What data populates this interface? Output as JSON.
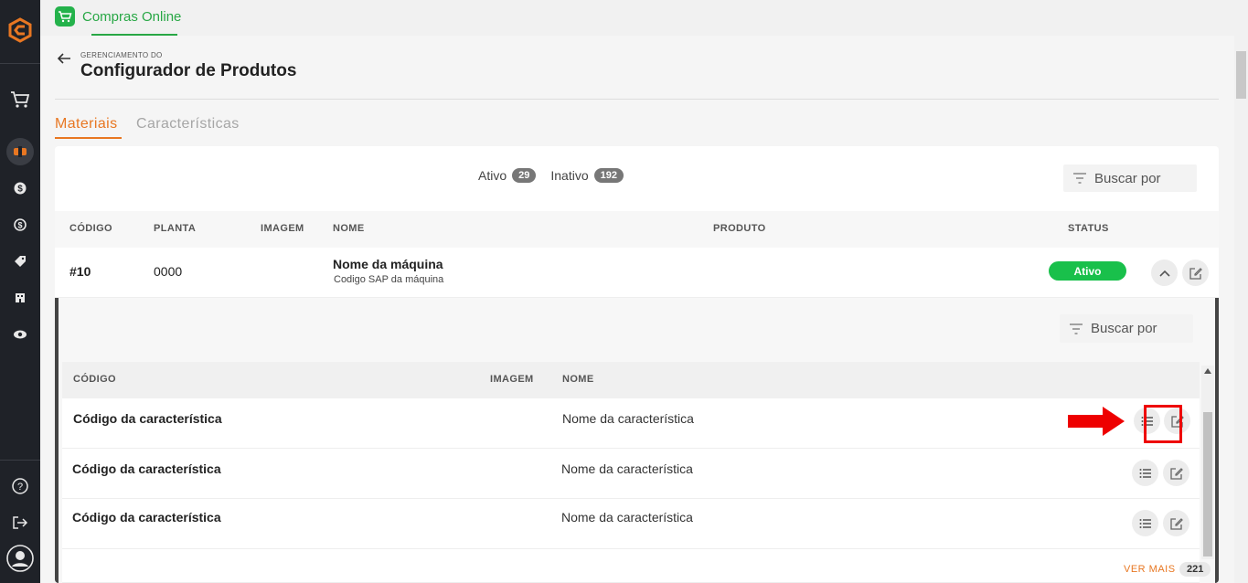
{
  "app": {
    "title": "Compras Online"
  },
  "header": {
    "breadcrumb": "GERENCIAMENTO DO",
    "title": "Configurador de Produtos"
  },
  "tabs": [
    {
      "label": "Materiais",
      "active": true
    },
    {
      "label": "Características",
      "active": false
    }
  ],
  "filters": {
    "active_label": "Ativo",
    "active_count": "29",
    "inactive_label": "Inativo",
    "inactive_count": "192",
    "search_placeholder": "Buscar por"
  },
  "table": {
    "columns": [
      "CÓDIGO",
      "PLANTA",
      "IMAGEM",
      "NOME",
      "PRODUTO",
      "STATUS"
    ],
    "row": {
      "code": "#10",
      "plant": "0000",
      "name": "Nome da máquina",
      "sap": "Codigo SAP da máquina",
      "status": "Ativo"
    }
  },
  "inner": {
    "search_placeholder": "Buscar por",
    "columns": [
      "CÓDIGO",
      "IMAGEM",
      "NOME"
    ],
    "rows": [
      {
        "code": "Código da característica",
        "name": "Nome da característica"
      },
      {
        "code": "Código da característica",
        "name": "Nome da característica"
      },
      {
        "code": "Código da característica",
        "name": "Nome da característica"
      }
    ]
  },
  "footer": {
    "ver_mais": "VER MAIS",
    "count": "221"
  },
  "colors": {
    "accent": "#e87722",
    "brand_green": "#28a745",
    "status_green": "#19c04b",
    "sidebar": "#1f2228",
    "highlight": "#ee0000"
  }
}
